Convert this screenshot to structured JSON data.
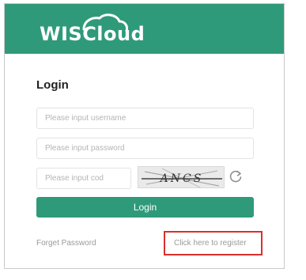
{
  "brand": {
    "logo_text": "WISCloud",
    "header_color": "#2f9a7a"
  },
  "login_form": {
    "title": "Login",
    "username": {
      "placeholder": "Please input username",
      "value": ""
    },
    "password": {
      "placeholder": "Please input password",
      "value": ""
    },
    "code": {
      "placeholder": "Please input cod",
      "value": ""
    },
    "captcha": {
      "text": "ANCS"
    },
    "refresh_icon": "refresh-icon",
    "submit_label": "Login"
  },
  "links": {
    "forget_password": "Forget Password",
    "register": "Click here to register"
  },
  "colors": {
    "accent": "#2f9a7a",
    "highlight_box": "#d9302c"
  }
}
